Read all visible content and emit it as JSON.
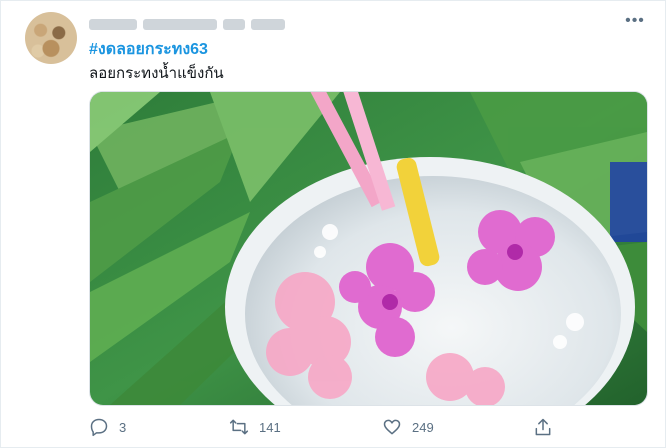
{
  "tweet": {
    "hashtag": "#งดลอยกระทง63",
    "text": "ลอยกระทงน้ำแข็งกัน",
    "more_icon": "more-horizontal-icon"
  },
  "actions": {
    "reply": {
      "icon": "reply-icon",
      "count": "3"
    },
    "retweet": {
      "icon": "retweet-icon",
      "count": "141"
    },
    "like": {
      "icon": "heart-icon",
      "count": "249"
    },
    "share": {
      "icon": "share-icon"
    }
  },
  "colors": {
    "link": "#1b95e0",
    "text": "#0f1419",
    "muted": "#5b7083"
  }
}
